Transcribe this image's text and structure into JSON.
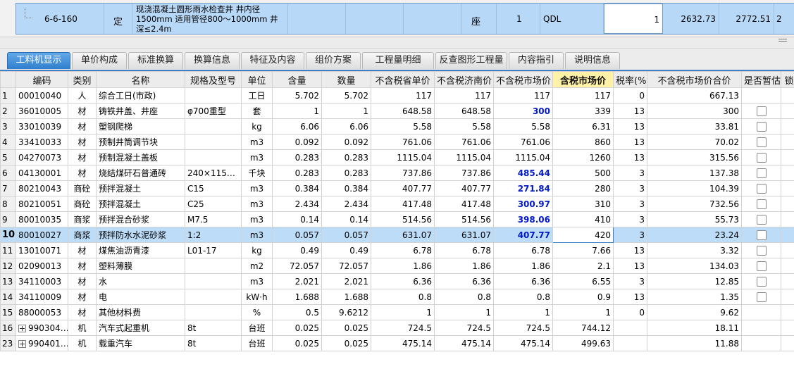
{
  "top_item": {
    "code": "6-6-160",
    "type": "定",
    "name": "现浇混凝土圆形雨水检查井 井内径1500mm 适用管径800～1000mm 井深≤2.4m",
    "unit": "座",
    "quantity": "1",
    "qdl": "QDL",
    "edit_value": "1",
    "price1": "2632.73",
    "price2": "2772.51",
    "price3": "2"
  },
  "tabs": [
    {
      "label": "工料机显示",
      "active": true
    },
    {
      "label": "单价构成"
    },
    {
      "label": "标准换算"
    },
    {
      "label": "换算信息"
    },
    {
      "label": "特征及内容"
    },
    {
      "label": "组价方案"
    },
    {
      "label": "工程量明细"
    },
    {
      "label": "反查图形工程量"
    },
    {
      "label": "内容指引"
    },
    {
      "label": "说明信息"
    }
  ],
  "columns": [
    "",
    "编码",
    "类别",
    "名称",
    "规格及型号",
    "单位",
    "含量",
    "数量",
    "不含税省单价",
    "不含税济南价",
    "不含税市场价",
    "含税市场价",
    "税率(%)",
    "不含税市场价合价",
    "是否暂估",
    "锁"
  ],
  "rows": [
    {
      "idx": "1",
      "code": "00010040",
      "type": "人",
      "name": "综合工日(市政)",
      "spec": "",
      "unit": "工日",
      "content": "5.702",
      "qty": "5.702",
      "p1": "117",
      "p2": "117",
      "p3": "117",
      "p3blue": false,
      "p4": "117",
      "tax": "0",
      "total": "667.13",
      "chk": false
    },
    {
      "idx": "2",
      "code": "36010005",
      "type": "材",
      "name": "铸铁井盖、井座",
      "spec": "φ700重型",
      "unit": "套",
      "content": "1",
      "qty": "1",
      "p1": "648.58",
      "p2": "648.58",
      "p3": "300",
      "p3blue": true,
      "p4": "339",
      "tax": "13",
      "total": "300",
      "chk": true
    },
    {
      "idx": "3",
      "code": "33010039",
      "type": "材",
      "name": "塑钢爬梯",
      "spec": "",
      "unit": "kg",
      "content": "6.06",
      "qty": "6.06",
      "p1": "5.58",
      "p2": "5.58",
      "p3": "5.58",
      "p3blue": false,
      "p4": "6.31",
      "tax": "13",
      "total": "33.81",
      "chk": true
    },
    {
      "idx": "4",
      "code": "33410033",
      "type": "材",
      "name": "预制井筒调节块",
      "spec": "",
      "unit": "m3",
      "content": "0.092",
      "qty": "0.092",
      "p1": "761.06",
      "p2": "761.06",
      "p3": "761.06",
      "p3blue": false,
      "p4": "860",
      "tax": "13",
      "total": "70.02",
      "chk": true
    },
    {
      "idx": "5",
      "code": "04270073",
      "type": "材",
      "name": "预制混凝土盖板",
      "spec": "",
      "unit": "m3",
      "content": "0.283",
      "qty": "0.283",
      "p1": "1115.04",
      "p2": "1115.04",
      "p3": "1115.04",
      "p3blue": false,
      "p4": "1260",
      "tax": "13",
      "total": "315.56",
      "chk": true
    },
    {
      "idx": "6",
      "code": "04130001",
      "type": "材",
      "name": "烧结煤矸石普通砖",
      "spec": "240×115…",
      "unit": "千块",
      "content": "0.283",
      "qty": "0.283",
      "p1": "737.86",
      "p2": "737.86",
      "p3": "485.44",
      "p3blue": true,
      "p4": "500",
      "tax": "3",
      "total": "137.38",
      "chk": true
    },
    {
      "idx": "7",
      "code": "80210043",
      "type": "商砼",
      "name": "预拌混凝土",
      "spec": "C15",
      "unit": "m3",
      "content": "0.384",
      "qty": "0.384",
      "p1": "407.77",
      "p2": "407.77",
      "p3": "271.84",
      "p3blue": true,
      "p4": "280",
      "tax": "3",
      "total": "104.39",
      "chk": true
    },
    {
      "idx": "8",
      "code": "80210051",
      "type": "商砼",
      "name": "预拌混凝土",
      "spec": "C25",
      "unit": "m3",
      "content": "2.434",
      "qty": "2.434",
      "p1": "417.48",
      "p2": "417.48",
      "p3": "300.97",
      "p3blue": true,
      "p4": "310",
      "tax": "3",
      "total": "732.56",
      "chk": true
    },
    {
      "idx": "9",
      "code": "80010035",
      "type": "商浆",
      "name": "预拌混合砂浆",
      "spec": "M7.5",
      "unit": "m3",
      "content": "0.14",
      "qty": "0.14",
      "p1": "514.56",
      "p2": "514.56",
      "p3": "398.06",
      "p3blue": true,
      "p4": "410",
      "tax": "3",
      "total": "55.73",
      "chk": true
    },
    {
      "idx": "10",
      "code": "80010027",
      "type": "商浆",
      "name": "预拌防水水泥砂浆",
      "spec": "1:2",
      "unit": "m3",
      "content": "0.057",
      "qty": "0.057",
      "p1": "631.07",
      "p2": "631.07",
      "p3": "407.77",
      "p3blue": true,
      "p4": "420",
      "tax": "3",
      "total": "23.24",
      "chk": true,
      "selected": true
    },
    {
      "idx": "11",
      "code": "13010071",
      "type": "材",
      "name": "煤焦油沥青漆",
      "spec": "L01-17",
      "unit": "kg",
      "content": "0.49",
      "qty": "0.49",
      "p1": "6.78",
      "p2": "6.78",
      "p3": "6.78",
      "p3blue": false,
      "p4": "7.66",
      "tax": "13",
      "total": "3.32",
      "chk": true
    },
    {
      "idx": "12",
      "code": "02090013",
      "type": "材",
      "name": "塑料薄膜",
      "spec": "",
      "unit": "m2",
      "content": "72.057",
      "qty": "72.057",
      "p1": "1.86",
      "p2": "1.86",
      "p3": "1.86",
      "p3blue": false,
      "p4": "2.1",
      "tax": "13",
      "total": "134.03",
      "chk": true
    },
    {
      "idx": "13",
      "code": "34110003",
      "type": "材",
      "name": "水",
      "spec": "",
      "unit": "m3",
      "content": "2.021",
      "qty": "2.021",
      "p1": "6.36",
      "p2": "6.36",
      "p3": "6.36",
      "p3blue": false,
      "p4": "6.55",
      "tax": "3",
      "total": "12.85",
      "chk": true
    },
    {
      "idx": "14",
      "code": "34110009",
      "type": "材",
      "name": "电",
      "spec": "",
      "unit": "kW·h",
      "content": "1.688",
      "qty": "1.688",
      "p1": "0.8",
      "p2": "0.8",
      "p3": "0.8",
      "p3blue": false,
      "p4": "0.9",
      "tax": "13",
      "total": "1.35",
      "chk": true
    },
    {
      "idx": "15",
      "code": "88000053",
      "type": "材",
      "name": "其他材料费",
      "spec": "",
      "unit": "%",
      "content": "0.5",
      "qty": "9.6212",
      "p1": "1",
      "p2": "1",
      "p3": "1",
      "p3blue": false,
      "p4": "1",
      "tax": "0",
      "total": "9.62",
      "chk": false
    },
    {
      "idx": "16",
      "code": "990304…",
      "type": "机",
      "name": "汽车式起重机",
      "spec": "8t",
      "unit": "台班",
      "content": "0.025",
      "qty": "0.025",
      "p1": "724.5",
      "p2": "724.5",
      "p3": "724.5",
      "p3blue": false,
      "p4": "744.12",
      "tax": "",
      "total": "18.11",
      "chk": false,
      "expander": true
    },
    {
      "idx": "23",
      "code": "990401…",
      "type": "机",
      "name": "载重汽车",
      "spec": "8t",
      "unit": "台班",
      "content": "0.025",
      "qty": "0.025",
      "p1": "475.14",
      "p2": "475.14",
      "p3": "475.14",
      "p3blue": false,
      "p4": "499.63",
      "tax": "",
      "total": "11.88",
      "chk": false,
      "expander": true
    }
  ]
}
